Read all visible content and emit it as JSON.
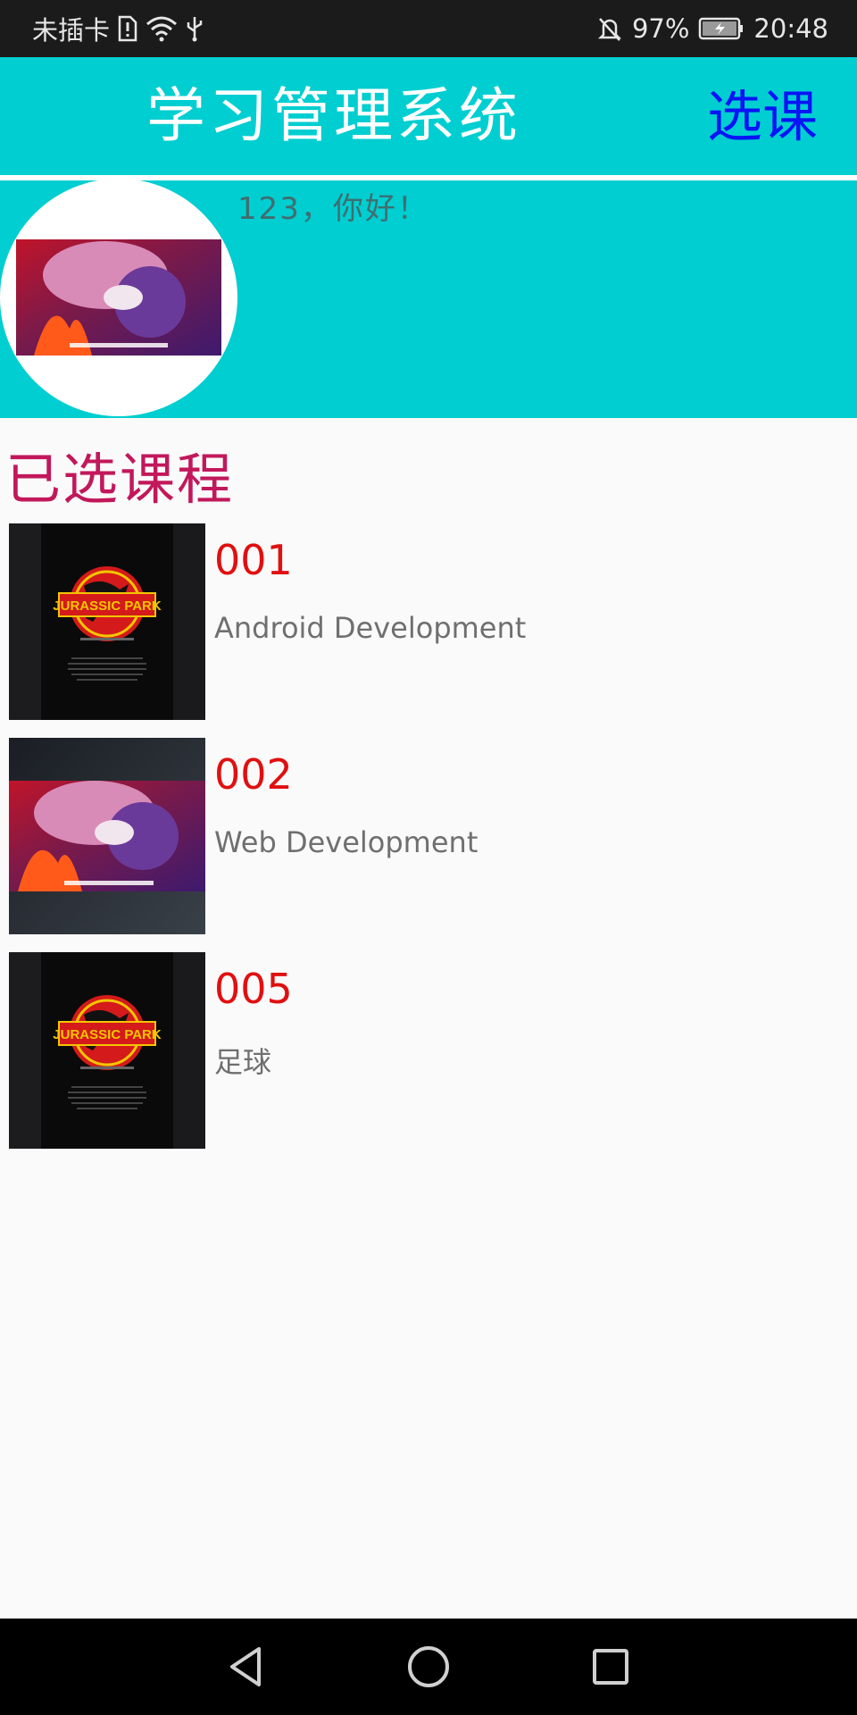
{
  "status_bar": {
    "carrier": "未插卡",
    "battery_percent": "97%",
    "time": "20:48",
    "icons": [
      "sim-alert-icon",
      "wifi-icon",
      "usb-icon",
      "mute-bell-icon",
      "battery-charging-icon"
    ]
  },
  "app": {
    "title": "学习管理系统",
    "action_label": "选课",
    "colors": {
      "header": "#00ced1",
      "action": "#0a14f5",
      "section": "#c2185b",
      "course_id": "#e01010"
    }
  },
  "profile": {
    "greeting": "123，你好！",
    "avatar": "avatar-image"
  },
  "section": {
    "title": "已选课程"
  },
  "courses": [
    {
      "id": "001",
      "name": "Android Development",
      "thumb": "jurassic-park-poster"
    },
    {
      "id": "002",
      "name": "Web Development",
      "thumb": "anime-still"
    },
    {
      "id": "005",
      "name": "足球",
      "thumb": "jurassic-park-poster"
    }
  ],
  "poster": {
    "title": "JURASSIC PARK"
  },
  "navbar": {
    "icons": [
      "back-icon",
      "home-icon",
      "recents-icon"
    ]
  }
}
